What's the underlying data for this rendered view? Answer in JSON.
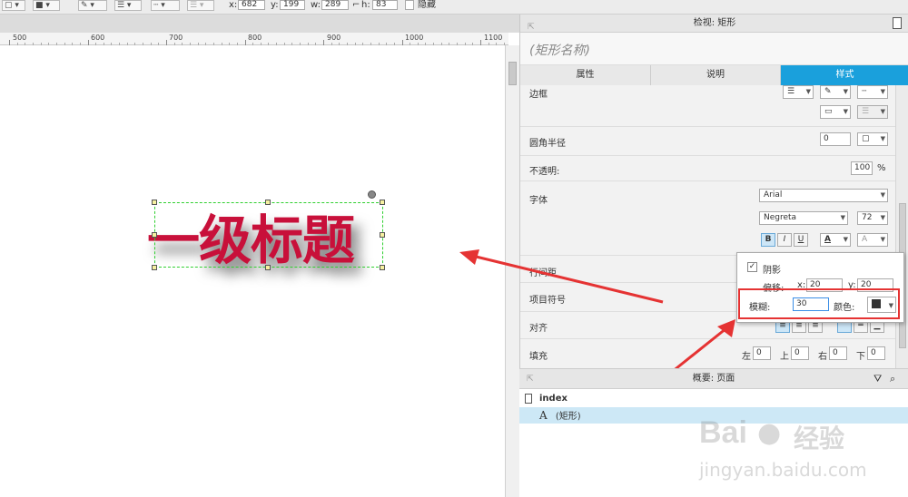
{
  "toolbar": {
    "x_label": "x:",
    "x_value": "682",
    "y_label": "y:",
    "y_value": "199",
    "w_label": "w:",
    "w_value": "289",
    "h_label": "h:",
    "h_value": "83",
    "hidden_label": "隐藏"
  },
  "ruler": {
    "labels": [
      "500",
      "600",
      "700",
      "800",
      "900",
      "1000",
      "1100"
    ]
  },
  "canvas": {
    "heading_text": "一级标题"
  },
  "inspector": {
    "title": "检视: 矩形",
    "shape_name": "(矩形名称)",
    "tabs": [
      {
        "label": "属性",
        "active": false
      },
      {
        "label": "说明",
        "active": false
      },
      {
        "label": "样式",
        "active": true
      }
    ],
    "border_label": "边框",
    "corner_radius_label": "圆角半径",
    "corner_radius_value": "0",
    "opacity_label": "不透明:",
    "opacity_value": "100",
    "opacity_unit": "%",
    "font_label": "字体",
    "font_family": "Arial",
    "font_weight": "Negreta",
    "font_size": "72",
    "bold_btn": "B",
    "italic_btn": "I",
    "underline_btn": "U",
    "font_color_btn": "A",
    "text_shadow_btn": "A",
    "line_spacing_label": "行间距",
    "bullets_label": "项目符号",
    "align_label": "对齐",
    "padding_label": "填充",
    "padding": {
      "left_label": "左",
      "left_value": "0",
      "top_label": "上",
      "top_value": "0",
      "right_label": "右",
      "right_value": "0",
      "bottom_label": "下",
      "bottom_value": "0"
    }
  },
  "shadow_popup": {
    "checkbox_label": "阴影",
    "checked": true,
    "offset_label": "偏移:",
    "x_label": "x:",
    "x_value": "20",
    "y_label": "y:",
    "y_value": "20",
    "blur_label": "模糊:",
    "blur_value": "30",
    "color_label": "颜色:"
  },
  "outline": {
    "title": "概要: 页面",
    "items": [
      {
        "label": "index",
        "icon": "page-icon"
      },
      {
        "label": "(矩形)",
        "icon": "text-shape-icon"
      }
    ]
  },
  "watermark": {
    "brand_a": "Bai",
    "brand_b": "经验",
    "url": "jingyan.baidu.com"
  },
  "colors": {
    "accent": "#1aa0dc",
    "heading": "#c8103a",
    "highlight": "#e53333"
  }
}
